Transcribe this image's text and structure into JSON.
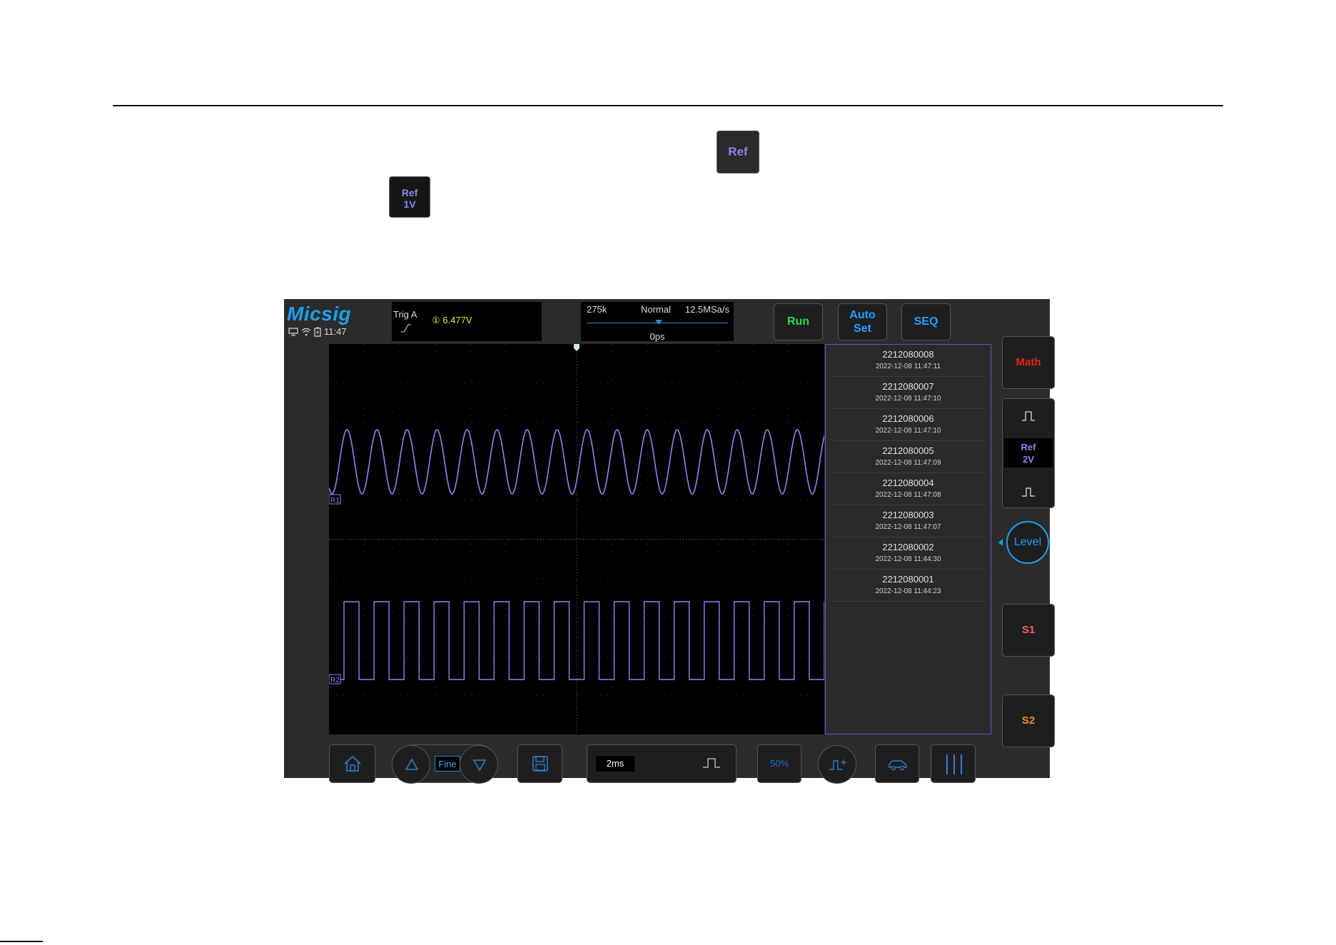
{
  "doc": {
    "ref_button": "Ref",
    "ref1v_line1": "Ref",
    "ref1v_line2": "1V"
  },
  "header": {
    "logo": "Micsig",
    "time": "11:47",
    "trigger": {
      "label": "Trig  A",
      "channel": "①",
      "level": "6.477V"
    },
    "timebase": {
      "memory": "275k",
      "mode": "Normal",
      "rate": "12.5MSa/s",
      "offset": "0ps"
    },
    "buttons": {
      "run": "Run",
      "auto_line1": "Auto",
      "auto_line2": "Set",
      "seq": "SEQ"
    }
  },
  "waveforms": {
    "r1_label": "R1",
    "r2_label": "R2"
  },
  "ref_list": [
    {
      "id": "2212080008",
      "date": "2022-12-08 11:47:11"
    },
    {
      "id": "2212080007",
      "date": "2022-12-08 11:47:10"
    },
    {
      "id": "2212080006",
      "date": "2022-12-08 11:47:10"
    },
    {
      "id": "2212080005",
      "date": "2022-12-08 11:47:09"
    },
    {
      "id": "2212080004",
      "date": "2022-12-08 11:47:08"
    },
    {
      "id": "2212080003",
      "date": "2022-12-08 11:47:07"
    },
    {
      "id": "2212080002",
      "date": "2022-12-08 11:44:30"
    },
    {
      "id": "2212080001",
      "date": "2022-12-08 11:44:23"
    }
  ],
  "side": {
    "math": "Math",
    "ref_line1": "Ref",
    "ref_line2": "2V",
    "level": "Level",
    "s1": "S1",
    "s2": "S2"
  },
  "bottom": {
    "fine": "Fine",
    "timediv": "2ms",
    "fifty": "50%"
  },
  "colors": {
    "accent": "#1aa0ef",
    "ref_trace": "#8c86f0",
    "run": "#28d94a",
    "math": "#e0251e",
    "s1": "#f0635c",
    "s2": "#f08a1a"
  }
}
